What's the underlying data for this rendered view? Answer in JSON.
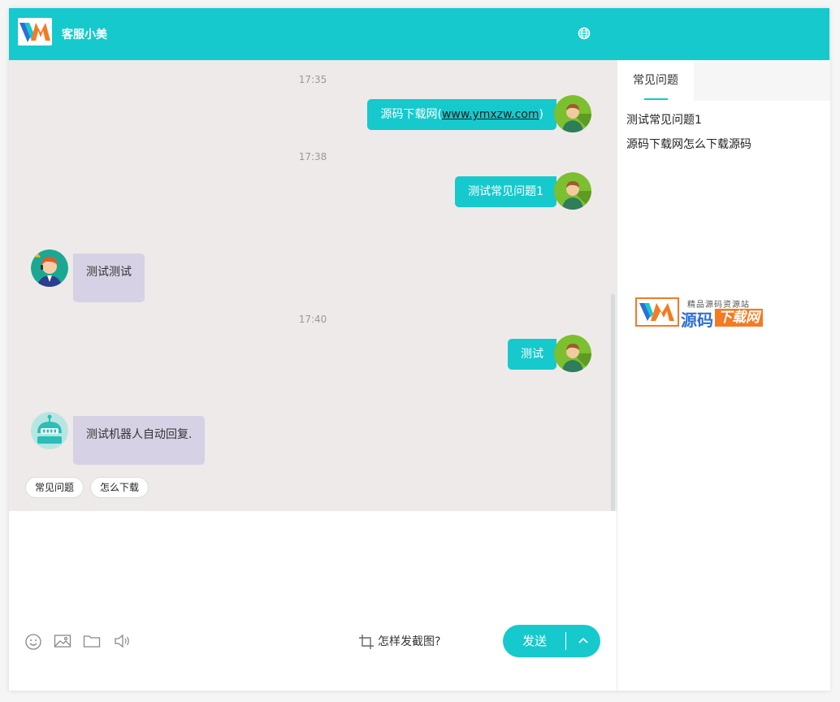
{
  "header": {
    "title": "客服小美"
  },
  "chat": {
    "messages": [
      {
        "time": "17:35",
        "from": "user",
        "text_before": "源码下载网(",
        "link": "www.ymxzw.com",
        "text_after": ")"
      },
      {
        "time": "17:38",
        "from": "user",
        "text": "测试常见问题1"
      },
      {
        "from": "agent",
        "text": "测试测试"
      },
      {
        "time": "17:40",
        "from": "user",
        "text": "测试"
      },
      {
        "from": "bot",
        "text": "测试机器人自动回复."
      }
    ],
    "quick_replies": [
      "常见问题",
      "怎么下载"
    ]
  },
  "input": {
    "placeholder": "",
    "crop_tip": "怎样发截图?",
    "send_label": "发送",
    "tools": [
      "emoji-icon",
      "image-icon",
      "folder-icon",
      "speaker-icon"
    ]
  },
  "side": {
    "tabs": [
      "常见问题"
    ],
    "faq_items": [
      "测试常见问题1",
      "源码下载网怎么下载源码"
    ],
    "brand": {
      "tagline": "精品源码资源站",
      "name_part1": "源码",
      "name_part2": "下载网"
    }
  },
  "colors": {
    "accent": "#16c9cd",
    "chat_bg": "#eeeae9",
    "agent_bubble": "#d6d1e4",
    "brand_orange": "#f57a22",
    "brand_blue": "#2e6fd6"
  }
}
